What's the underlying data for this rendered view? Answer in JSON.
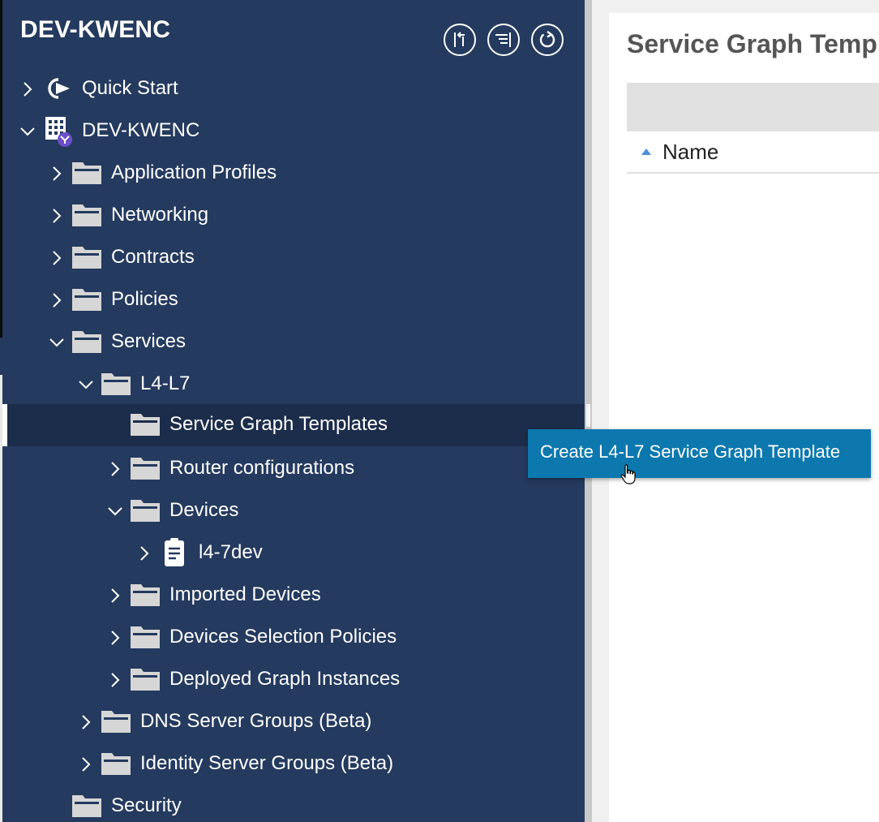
{
  "sidebar": {
    "title": "DEV-KWENC",
    "header_buttons": [
      {
        "name": "collapse-tree-icon"
      },
      {
        "name": "list-actions-icon"
      },
      {
        "name": "refresh-icon"
      }
    ],
    "tree": [
      {
        "label": "Quick Start",
        "icon": "quick-start-icon",
        "expanded": false
      },
      {
        "label": "DEV-KWENC",
        "icon": "tenant-icon",
        "expanded": true
      },
      {
        "label": "Application Profiles",
        "icon": "folder-icon",
        "expanded": false
      },
      {
        "label": "Networking",
        "icon": "folder-icon",
        "expanded": false
      },
      {
        "label": "Contracts",
        "icon": "folder-icon",
        "expanded": false
      },
      {
        "label": "Policies",
        "icon": "folder-icon",
        "expanded": false
      },
      {
        "label": "Services",
        "icon": "folder-icon",
        "expanded": true
      },
      {
        "label": "L4-L7",
        "icon": "folder-icon",
        "expanded": true
      },
      {
        "label": "Service Graph Templates",
        "icon": "folder-icon",
        "selected": true
      },
      {
        "label": "Router configurations",
        "icon": "folder-icon",
        "expanded": false
      },
      {
        "label": "Devices",
        "icon": "folder-icon",
        "expanded": true
      },
      {
        "label": "l4-7dev",
        "icon": "device-doc-icon",
        "expanded": false
      },
      {
        "label": "Imported Devices",
        "icon": "folder-icon",
        "expanded": false
      },
      {
        "label": "Devices Selection Policies",
        "icon": "folder-icon",
        "expanded": false
      },
      {
        "label": "Deployed Graph Instances",
        "icon": "folder-icon",
        "expanded": false
      },
      {
        "label": "DNS Server Groups (Beta)",
        "icon": "folder-icon",
        "expanded": false
      },
      {
        "label": "Identity Server Groups (Beta)",
        "icon": "folder-icon",
        "expanded": false
      },
      {
        "label": "Security",
        "icon": "folder-icon"
      }
    ]
  },
  "main": {
    "title": "Service Graph Temp",
    "columns": [
      {
        "label": "Name",
        "sort": "ascending"
      }
    ]
  },
  "context_menu": {
    "create_label": "Create L4-L7 Service Graph Template"
  },
  "colors": {
    "sidebar_bg": "#243a5e",
    "selected_bg": "#1c2d4b",
    "tooltip_bg": "#0c78ad",
    "folder_icon": "#d6d6d6"
  }
}
